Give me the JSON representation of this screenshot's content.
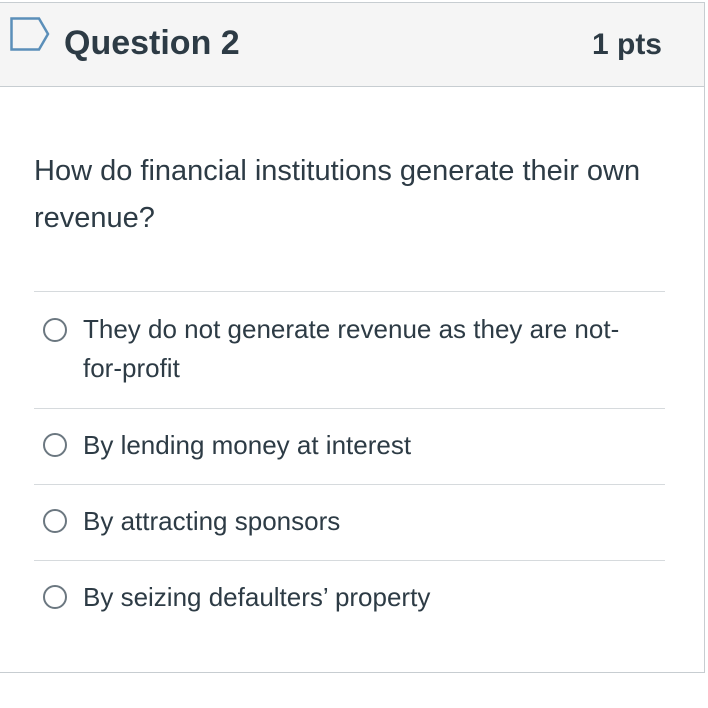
{
  "question": {
    "title": "Question 2",
    "points": "1 pts",
    "flag_icon": "flag-outline-icon",
    "text": "How do financial institutions generate their own revenue?"
  },
  "answers": [
    {
      "label": "They do not generate revenue as they are not-for-profit",
      "selected": false
    },
    {
      "label": "By lending money at interest",
      "selected": false
    },
    {
      "label": "By attracting sponsors",
      "selected": false
    },
    {
      "label": "By seizing defaulters’ property",
      "selected": false
    }
  ],
  "colors": {
    "text": "#2d3b45",
    "header_bg": "#f5f5f5",
    "border": "#c7cdd1",
    "flag": "#5b8fb9"
  }
}
